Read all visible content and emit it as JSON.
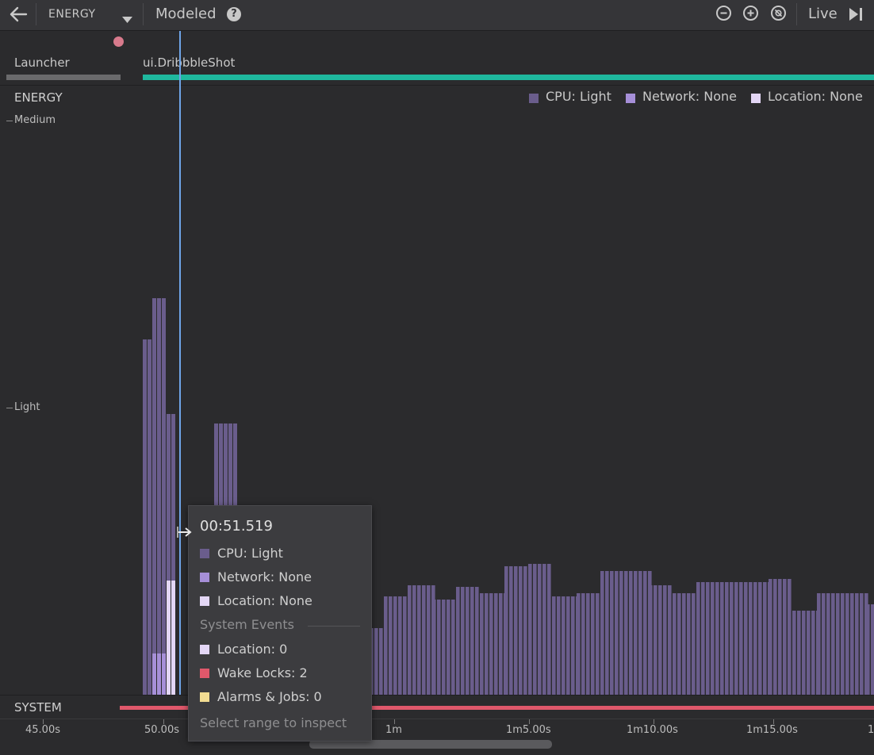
{
  "toolbar": {
    "monitor_label": "ENERGY",
    "mode_label": "Modeled",
    "live_label": "Live"
  },
  "events": {
    "activity_1": "Launcher",
    "activity_2": "ui.DribbbleShot"
  },
  "energy": {
    "section_label": "ENERGY",
    "level_medium": "Medium",
    "level_light": "Light",
    "legend": [
      {
        "label": "CPU: Light",
        "color": "#6a5d8c"
      },
      {
        "label": "Network: None",
        "color": "#a68fd8"
      },
      {
        "label": "Location: None",
        "color": "#e3d6f5"
      }
    ]
  },
  "system": {
    "section_label": "SYSTEM"
  },
  "axis": {
    "ticks": [
      "45.00s",
      "50.00s",
      "1m",
      "1m5.00s",
      "1m10.00s",
      "1m15.00s",
      "1"
    ]
  },
  "tooltip": {
    "time": "00:51.519",
    "cpu": "CPU: Light",
    "network": "Network: None",
    "location": "Location: None",
    "system_events_header": "System Events",
    "ev_location": "Location: 0",
    "ev_wakelocks": "Wake Locks: 2",
    "ev_alarms": "Alarms & Jobs: 0",
    "footer": "Select range to inspect"
  },
  "colors": {
    "cpu": "#6a5d8c",
    "network": "#a68fd8",
    "location": "#e3d6f5",
    "activity": "#1fb89e",
    "wakelock": "#e0586b",
    "alarms": "#f2dc92",
    "cursor": "#6fa5e8"
  }
}
